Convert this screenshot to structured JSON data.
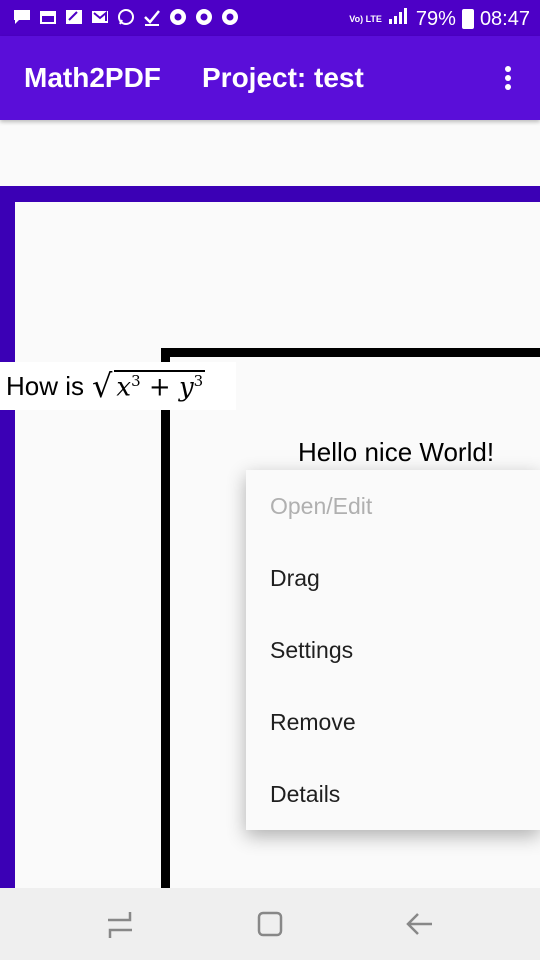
{
  "status_bar": {
    "battery": "79%",
    "time": "08:47",
    "network_label": "Vo) LTE",
    "left_icons": [
      "message-icon",
      "calendar-icon",
      "sticky-note-icon",
      "gmail-icon",
      "whatsapp-icon",
      "check-icon",
      "chrome-icon",
      "chrome-icon",
      "chrome-icon"
    ]
  },
  "app_bar": {
    "app_name": "Math2PDF",
    "project_title": "Project: test"
  },
  "document": {
    "question_text": "How is",
    "formula": {
      "x_var": "x",
      "x_exp": "3",
      "plus": "+",
      "y_var": "y",
      "y_exp": "3"
    },
    "greeting_text": "Hello nice World!"
  },
  "context_menu": {
    "items": [
      {
        "label": "Open/Edit",
        "enabled": false
      },
      {
        "label": "Drag",
        "enabled": true
      },
      {
        "label": "Settings",
        "enabled": true
      },
      {
        "label": "Remove",
        "enabled": true
      },
      {
        "label": "Details",
        "enabled": true
      }
    ]
  },
  "colors": {
    "status_bar": "#4d00c6",
    "app_bar": "#5a0ed9",
    "canvas_border": "#3b00b5",
    "nav_bar": "#efefef"
  },
  "nav_bar": {
    "buttons": [
      "recents-icon",
      "home-icon",
      "back-icon"
    ]
  }
}
